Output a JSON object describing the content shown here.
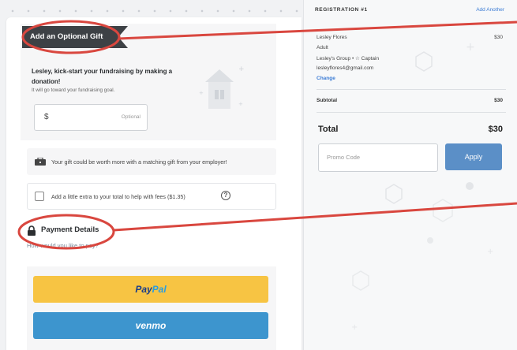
{
  "gift": {
    "banner": "Add an Optional Gift",
    "title": "Lesley, kick-start your fundraising by making a donation!",
    "subtitle": "It will go toward your fundraising goal.",
    "currency": "$",
    "amount_placeholder": "Optional"
  },
  "match": {
    "text": "Your gift could be worth more with a matching gift from your employer!",
    "icon": "briefcase-icon"
  },
  "fees": {
    "label": "Add a little extra to your total to help with fees ($1.35)",
    "help": "?",
    "checked": false
  },
  "payment": {
    "title": "Payment Details",
    "question": "How would you like to pay?",
    "paypal_part1": "Pay",
    "paypal_part2": "Pal",
    "venmo": "venmo"
  },
  "registration": {
    "header": "REGISTRATION #1",
    "add_another": "Add Another",
    "name": "Lesley Flores",
    "price": "$30",
    "type": "Adult",
    "group": "Lesley's Group  •  ☆ Captain",
    "email": "lesleyflores4@gmail.com",
    "change": "Change"
  },
  "summary": {
    "subtotal_label": "Subtotal",
    "subtotal_value": "$30",
    "total_label": "Total",
    "total_value": "$30",
    "promo_placeholder": "Promo Code",
    "apply": "Apply"
  },
  "colors": {
    "annotation": "#d9473f",
    "apply_button": "#5b8fc7",
    "paypal": "#f7c443",
    "venmo": "#3d95ce",
    "link": "#3a7bd5"
  }
}
